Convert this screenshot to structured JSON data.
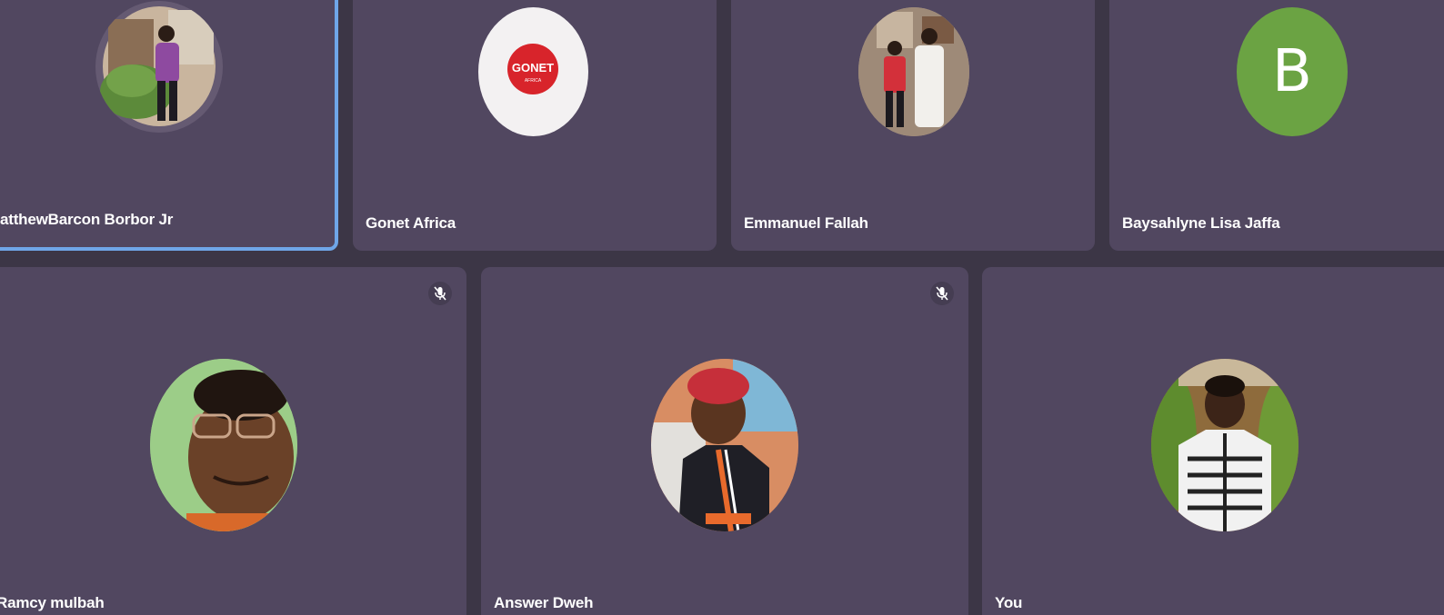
{
  "participants_row1": [
    {
      "name": "atthewBarcon Borbor Jr",
      "avatar": "photo",
      "active": true
    },
    {
      "name": "Gonet Africa",
      "avatar": "logo",
      "logo_text": "GONET",
      "logo_sub": "AFRICA"
    },
    {
      "name": "Emmanuel Fallah",
      "avatar": "photo"
    },
    {
      "name": "Baysahlyne Lisa Jaffa",
      "avatar": "initial",
      "initial": "B",
      "initial_color": "#6ba343"
    }
  ],
  "participants_row2": [
    {
      "name": "Ramcy mulbah",
      "avatar": "photo",
      "muted": true
    },
    {
      "name": "Answer Dweh",
      "avatar": "photo",
      "muted": true
    },
    {
      "name": "You",
      "avatar": "photo",
      "muted": false
    }
  ],
  "colors": {
    "background": "#3c3646",
    "tile": "#514760",
    "active_border": "#6fa6e8",
    "text": "#ffffff"
  },
  "icons": {
    "mute": "mic-off-icon"
  }
}
